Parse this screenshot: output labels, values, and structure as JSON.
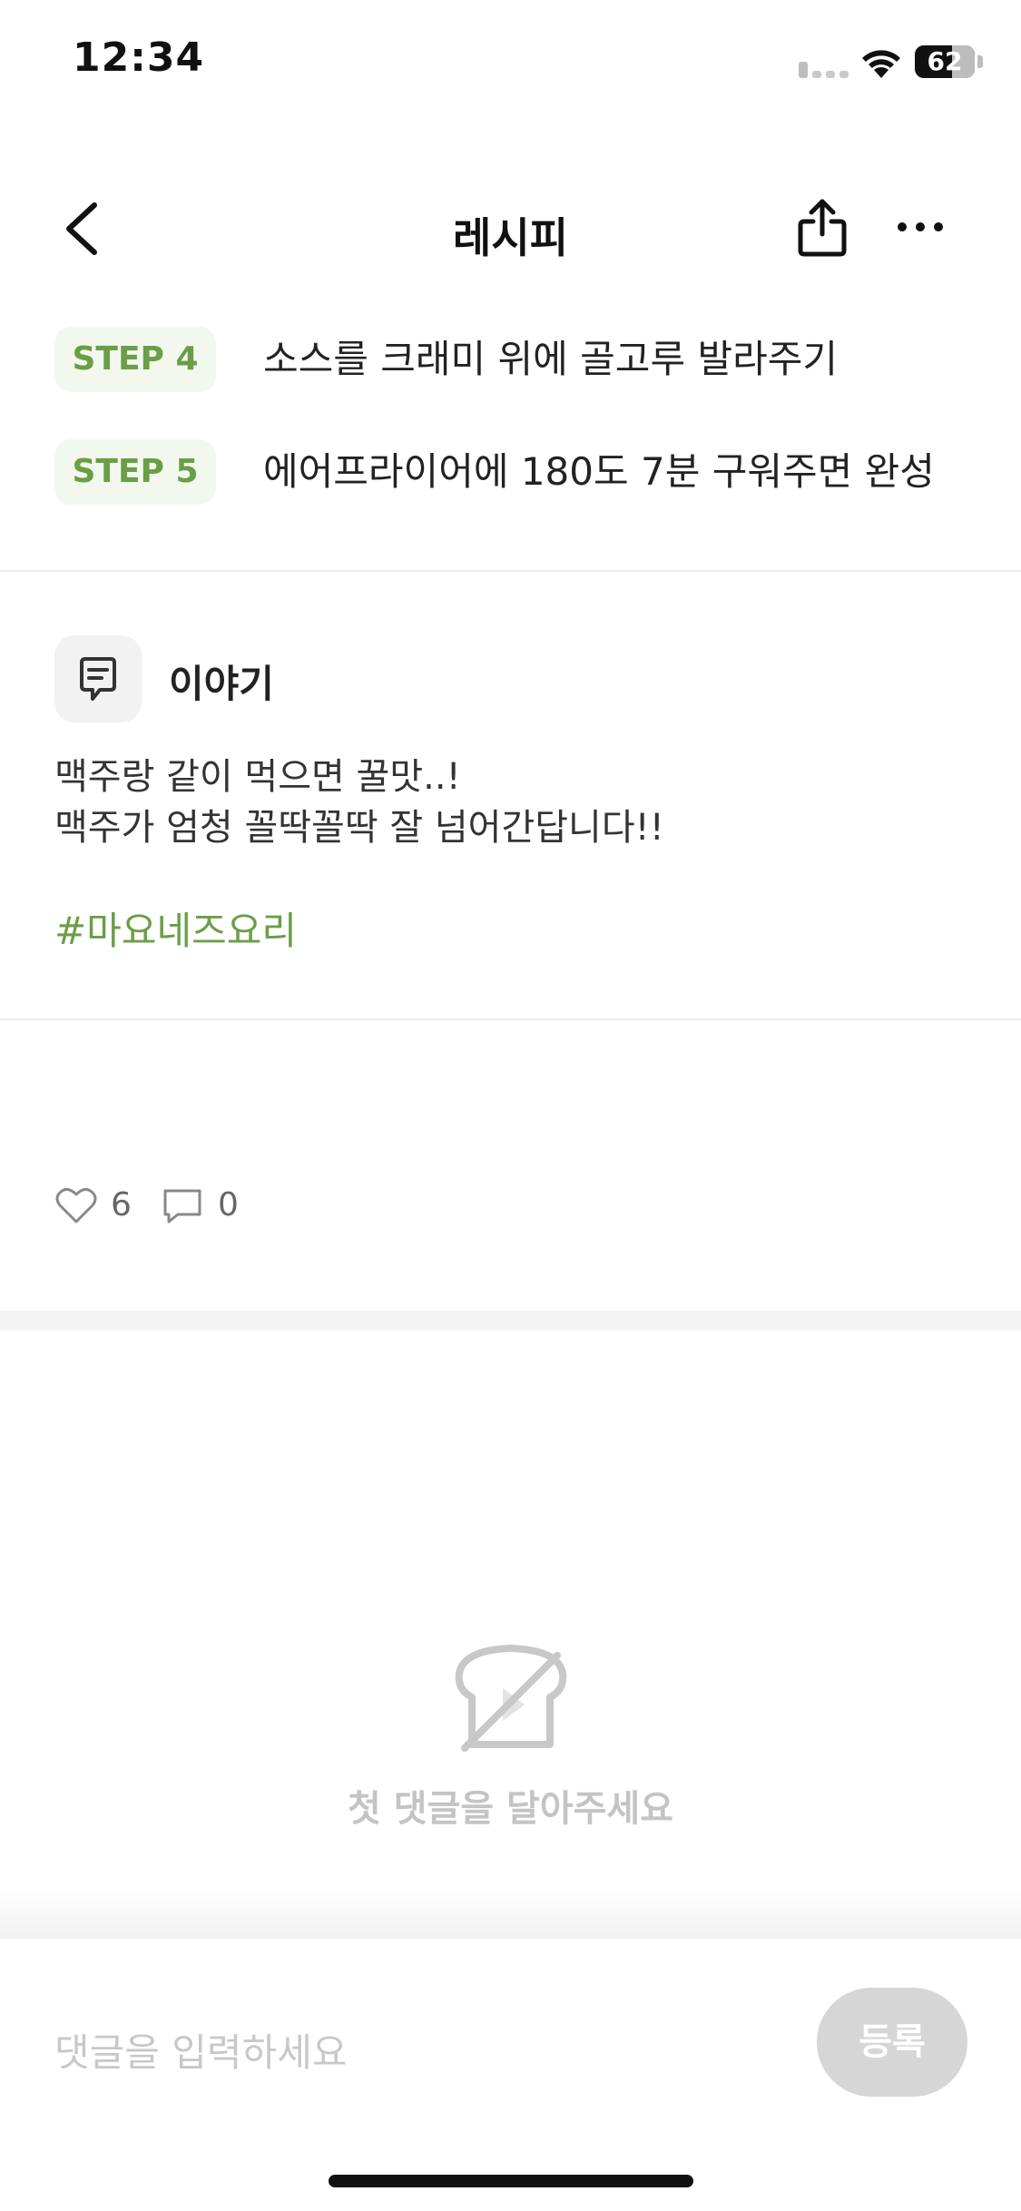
{
  "status_bar": {
    "time": "12:34",
    "battery": "62",
    "icons": [
      "cellular-signal-icon",
      "wifi-icon",
      "battery-icon"
    ]
  },
  "nav": {
    "title": "레시피",
    "icons": [
      "back-chevron-icon",
      "share-icon",
      "more-dots-icon"
    ]
  },
  "steps": [
    {
      "badge": "STEP 4",
      "text": "소스를 크래미 위에 골고루 발라주기"
    },
    {
      "badge": "STEP 5",
      "text": "에어프라이어에 180도 7분 구워주면 완성"
    }
  ],
  "story": {
    "title": "이야기",
    "icon": "chat-bubble-icon",
    "lines": [
      "맥주랑 같이 먹으면 꿀맛..!",
      "맥주가 엄청 꼴딱꼴딱 잘 넘어간답니다!!"
    ],
    "hashtag": "#마요네즈요리"
  },
  "stats": {
    "likes": "6",
    "comments": "0"
  },
  "comments": {
    "empty_message": "첫 댓글을 달아주세요",
    "empty_icon": "bread-slash-icon"
  },
  "comment_input": {
    "placeholder": "댓글을 입력하세요",
    "submit_label": "등록"
  },
  "colors": {
    "accent_green": "#6b9e47",
    "badge_bg": "#f3f8ef",
    "disabled_button": "#d6d6d6"
  }
}
